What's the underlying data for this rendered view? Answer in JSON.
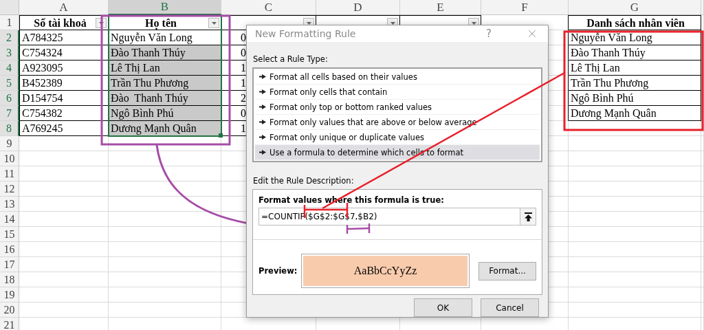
{
  "sheet": {
    "columns": [
      {
        "letter": "A",
        "selected": false
      },
      {
        "letter": "B",
        "selected": true
      },
      {
        "letter": "C",
        "selected": false
      },
      {
        "letter": "D",
        "selected": false
      },
      {
        "letter": "E",
        "selected": false
      },
      {
        "letter": "F",
        "selected": false
      },
      {
        "letter": "G",
        "selected": false
      }
    ],
    "header_row": {
      "number": "1",
      "selected": false,
      "account": {
        "text": "Số tài khoả",
        "filter": true
      },
      "name": {
        "text": "Họ tên",
        "filter": true
      },
      "opened": {
        "filter": true
      },
      "type": {
        "filter": true
      },
      "balance": {
        "filter": true
      },
      "employee_list": {
        "text": "Danh sách nhân viên"
      }
    },
    "rows": [
      {
        "number": "2",
        "selected": true,
        "account": "A784325",
        "name": "Nguyễn Văn Long",
        "highlighted": false,
        "opened": "0",
        "employee": "Nguyễn Văn Long"
      },
      {
        "number": "3",
        "selected": true,
        "account": "C754324",
        "name": "Đào Thanh Thúy",
        "highlighted": true,
        "opened": "0",
        "employee": "Đào Thanh Thúy"
      },
      {
        "number": "4",
        "selected": true,
        "account": "A923095",
        "name": "Lê Thị Lan",
        "highlighted": true,
        "opened": "1",
        "employee": "Lê Thị Lan"
      },
      {
        "number": "5",
        "selected": true,
        "account": "B452389",
        "name": "Trần Thu Phương",
        "highlighted": true,
        "opened": "1",
        "employee": "Trần Thu Phương"
      },
      {
        "number": "6",
        "selected": true,
        "account": "D154754",
        "name": "Đào  Thanh Thúy",
        "highlighted": true,
        "opened": "2",
        "employee": "Ngô Bình Phú"
      },
      {
        "number": "7",
        "selected": true,
        "account": "C754382",
        "name": "Ngô Bình Phú",
        "highlighted": true,
        "opened": "0",
        "employee": "Dương Mạnh Quân"
      },
      {
        "number": "8",
        "selected": true,
        "account": "A769245",
        "name": "Dương Mạnh Quân",
        "highlighted": true,
        "opened": "1"
      }
    ],
    "empty_rows": [
      {
        "number": "9"
      },
      {
        "number": "10"
      },
      {
        "number": "11"
      },
      {
        "number": "12"
      },
      {
        "number": "13"
      },
      {
        "number": "14"
      },
      {
        "number": "15"
      },
      {
        "number": "16"
      },
      {
        "number": "17"
      },
      {
        "number": "18"
      },
      {
        "number": "19"
      },
      {
        "number": "20"
      },
      {
        "number": "21"
      }
    ]
  },
  "dialog": {
    "title": "New Formatting Rule",
    "help": "?",
    "rule_type_label": "Select a Rule Type:",
    "rule_types": [
      {
        "text": "Format all cells based on their values",
        "selected": false
      },
      {
        "text": "Format only cells that contain",
        "selected": false
      },
      {
        "text": "Format only top or bottom ranked values",
        "selected": false
      },
      {
        "text": "Format only values that are above or below average",
        "selected": false
      },
      {
        "text": "Format only unique or duplicate values",
        "selected": false
      },
      {
        "text": "Use a formula to determine which cells to format",
        "selected": true
      }
    ],
    "description_label": "Edit the Rule Description:",
    "formula_label": "Format values where this formula is true:",
    "formula": "=COUNTIF($G$2:$G$7,$B2)",
    "preview_label": "Preview:",
    "preview_sample": "AaBbCcYyZz",
    "format_button": "Format...",
    "buttons": [
      "OK",
      "Cancel"
    ]
  }
}
